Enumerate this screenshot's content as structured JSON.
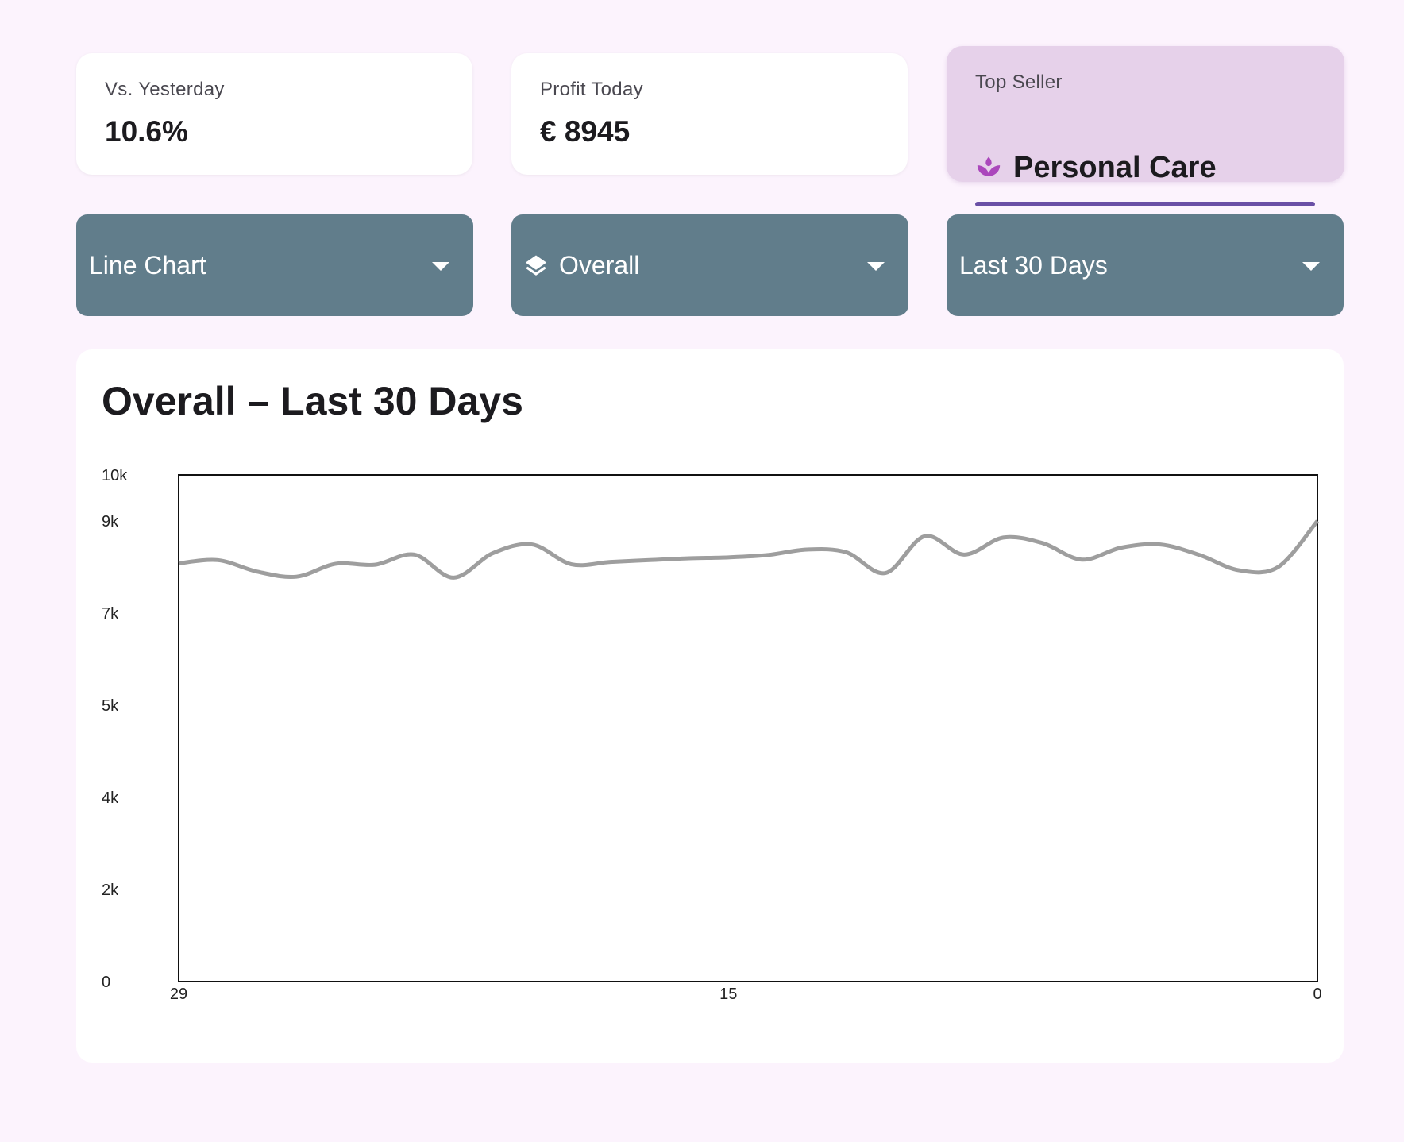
{
  "cards": {
    "yesterday": {
      "label": "Vs. Yesterday",
      "value": "10.6%"
    },
    "profit": {
      "label": "Profit Today",
      "value": "€ 8945"
    },
    "top_seller": {
      "label": "Top Seller",
      "value": "Personal Care",
      "icon": "spa-icon",
      "accent": "#ab47bc",
      "bar_color": "#6a4fa6"
    }
  },
  "dropdowns": {
    "chart_type": {
      "value": "Line Chart"
    },
    "category": {
      "value": "Overall",
      "icon": "layers-icon"
    },
    "period": {
      "value": "Last 30 Days"
    }
  },
  "chart_data": {
    "type": "line",
    "title": "Overall – Last 30 Days",
    "x": [
      29,
      28,
      27,
      26,
      25,
      24,
      23,
      22,
      21,
      20,
      19,
      18,
      17,
      16,
      15,
      14,
      13,
      12,
      11,
      10,
      9,
      8,
      7,
      6,
      5,
      4,
      3,
      2,
      1,
      0
    ],
    "x_ticks": [
      "29",
      "15",
      "0"
    ],
    "x_tick_values": [
      29,
      15,
      0
    ],
    "y_ticks": [
      "10k",
      "9k",
      "7k",
      "5k",
      "4k",
      "2k",
      "0"
    ],
    "y_tick_values": [
      11000,
      10000,
      8000,
      6000,
      4000,
      2000,
      0
    ],
    "ylim": [
      0,
      11000
    ],
    "xlim": [
      29,
      0
    ],
    "line_color": "#9e9e9e",
    "series": [
      {
        "values": [
          9080,
          9150,
          8900,
          8790,
          9070,
          9050,
          9270,
          8770,
          9300,
          9490,
          9060,
          9110,
          9150,
          9190,
          9210,
          9260,
          9380,
          9320,
          8870,
          9670,
          9270,
          9640,
          9520,
          9160,
          9420,
          9490,
          9260,
          8930,
          9000,
          10000
        ]
      }
    ]
  }
}
